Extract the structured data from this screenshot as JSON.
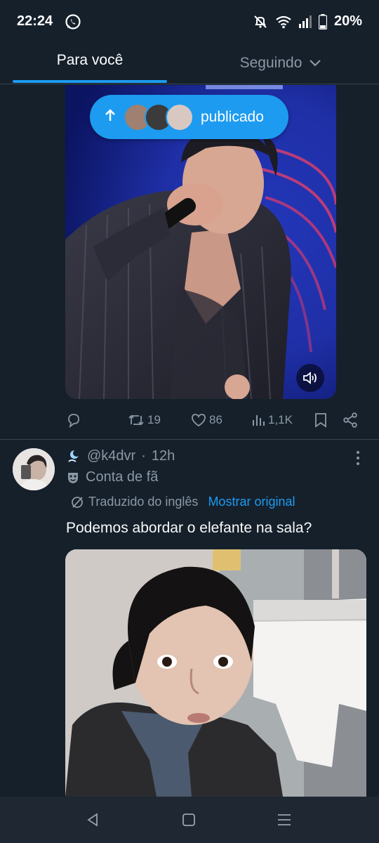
{
  "status_bar": {
    "time": "22:24",
    "battery": "20%",
    "icons": [
      "whatsapp-icon",
      "mute-icon",
      "wifi-icon",
      "signal-icon",
      "battery-icon"
    ]
  },
  "tabs": [
    {
      "label": "Para você",
      "active": true
    },
    {
      "label": "Seguindo",
      "active": false
    }
  ],
  "posted_pill": {
    "label": "publicado",
    "icon": "arrow-up-icon"
  },
  "post1": {
    "actions": {
      "reply_count": "",
      "retweet_count": "19",
      "like_count": "86",
      "views_count": "1,1K"
    },
    "media_controls": {
      "volume_icon": "volume-icon"
    }
  },
  "post2": {
    "handle": "@k4dvr",
    "separator": "·",
    "time": "12h",
    "badge": "Conta de fã",
    "translated_label": "Traduzido do inglês",
    "show_original": "Mostrar original",
    "text": "Podemos abordar o elefante na sala?"
  },
  "colors": {
    "background": "#15202b",
    "accent": "#1d9bf0",
    "muted_text": "#8b98a5",
    "divider": "#38444d"
  }
}
